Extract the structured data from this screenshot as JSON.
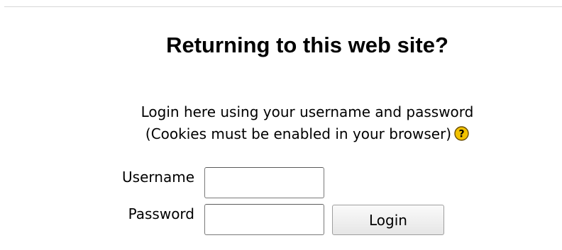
{
  "login": {
    "heading": "Returning to this web site?",
    "description_line1": "Login here using your username and password",
    "description_line2": "(Cookies must be enabled in your browser)",
    "help_icon": "question-mark-icon",
    "username_label": "Username",
    "username_value": "",
    "password_label": "Password",
    "password_value": "",
    "login_button_label": "Login"
  },
  "colors": {
    "help_icon_fill": "#f2c200",
    "help_icon_border": "#7a5a00"
  }
}
